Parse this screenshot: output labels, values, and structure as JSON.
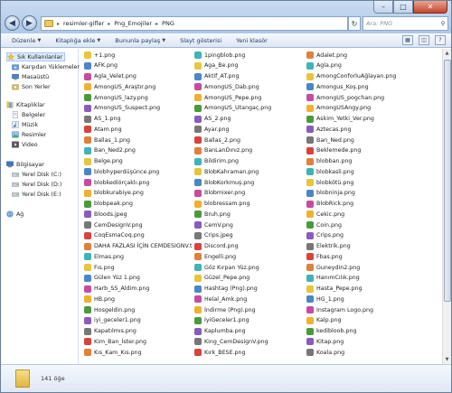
{
  "address": {
    "crumbs": [
      "resimler-gifler",
      "Png_Emojiler",
      "PNG"
    ]
  },
  "search": {
    "placeholder": "Ara: PNG"
  },
  "toolbar": {
    "organize": "Düzenle",
    "add_to_library": "Kitaplığa ekle",
    "share": "Bununla paylaş",
    "slideshow": "Slayt gösterisi",
    "new_folder": "Yeni klasör"
  },
  "nav": {
    "favorites": "Sık Kullanılanlar",
    "downloads": "Karşıdan Yüklemeler",
    "desktop": "Masaüstü",
    "recent": "Son Yerler",
    "libraries": "Kitaplıklar",
    "documents": "Belgeler",
    "music": "Müzik",
    "pictures": "Resimler",
    "videos": "Video",
    "computer": "Bilgisayar",
    "disk_c": "Yerel Disk (C:)",
    "disk_d": "Yerel Disk (D:)",
    "disk_e": "Yerel Disk (E:)",
    "network": "Ağ"
  },
  "files": {
    "col1": [
      "+1.png",
      "AFK.png",
      "Agla_Velet.png",
      "AmongUS_Araştır.png",
      "AmongUS_lazy.png",
      "AmongUS_Suspect.png",
      "AS_1.png",
      "Atam.png",
      "Ballas_1.png",
      "Ban_Ned2.png",
      "Belge.png",
      "blobhyperdüşünce.png",
      "blobkediörçaklı.png",
      "blobkurabiye.png",
      "blobpeak.png",
      "Bloods.jpeg",
      "CemDesignV.png",
      "CoqEsmaCoq.png",
      "DAHA FAZLASI İÇİN CEMDESIGNV.txt",
      "Elmas.png",
      "Fıs.png",
      "Gülen Yüz 1.png",
      "Harb_SS_Aldim.png",
      "HB.png",
      "Hosgeldin.png",
      "iyi_geceler1.png",
      "Kapatılmıs.png",
      "Kim_Ban_İster.png",
      "Kıs_Kam_Kıs.png"
    ],
    "col2": [
      "1pingblob.png",
      "Aga_Be.png",
      "Aktif_AT.png",
      "AmongUS_Dab.png",
      "AmongUS_Pepe.png",
      "AmongUS_Utangaç.png",
      "AS_2.png",
      "Ayar.png",
      "Ballas_2.png",
      "BanLanDınız.png",
      "Bildirim.png",
      "BlobKahraman.png",
      "BlobKorkmuş.png",
      "Blobmixer.png",
      "blobressam.png",
      "Bruh.png",
      "CemV.png",
      "Crips.jpeg",
      "Discord.png",
      "Engelli.png",
      "Göz Kırpan Yüz.png",
      "Güzel_Pepe.png",
      "Hashtag (Png).png",
      "Helal_Amk.png",
      "İndirme (Png).png",
      "İyiGeceler1.png",
      "Kaplumba.png",
      "King_CemDesignV.png",
      "Kırk_BESE.png"
    ],
    "col3": [
      "Adalet.png",
      "Agla.png",
      "AmongConforluAğlayan.png",
      "Amongus_Koş.png",
      "AmongUS_pogchan.png",
      "AmongUSAngy.png",
      "Askim_Yetki_Ver.png",
      "Aztecas.png",
      "Ban_Ned.png",
      "Beklemede.png",
      "blobban.png",
      "blobkasli.png",
      "blobkötü.png",
      "blobninja.png",
      "BlobRick.png",
      "Cekic.png",
      "Coin.png",
      "Crips.png",
      "Elektrik.png",
      "Fbas.png",
      "Guneydin2.png",
      "HanımCılık.png",
      "Hasta_Pepe.png",
      "HG_1.png",
      "Instagram Logo.png",
      "Kalp.png",
      "kedibloob.png",
      "Kitap.png",
      "Koala.png"
    ]
  },
  "status": {
    "count": "141 öğe"
  }
}
